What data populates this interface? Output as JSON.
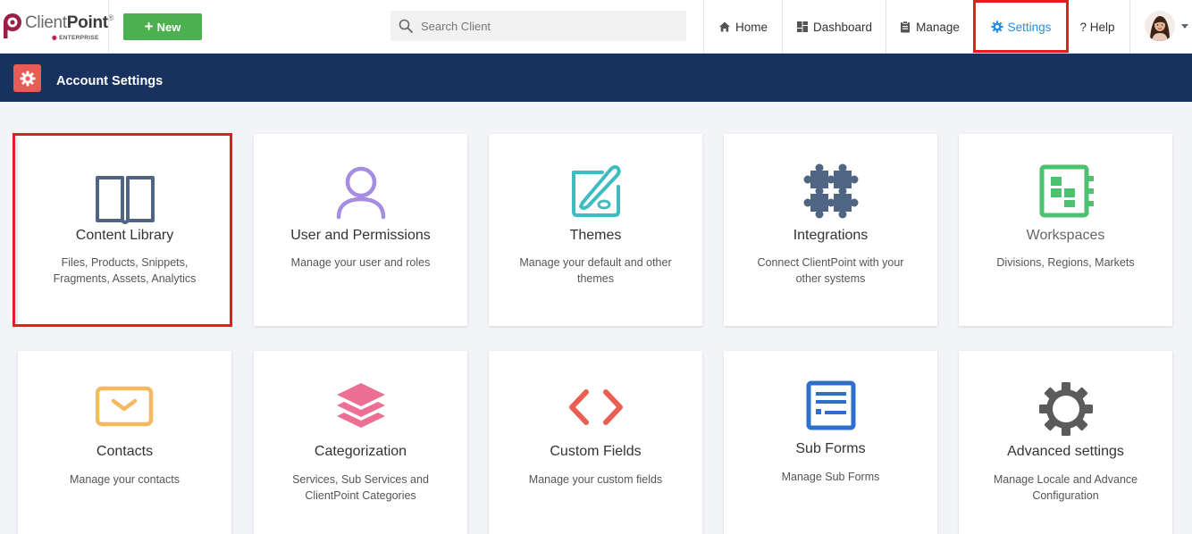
{
  "app": {
    "logo_text_light": "Client",
    "logo_text_bold": "Point",
    "logo_reg": "®",
    "logo_edition": "ENTERPRISE"
  },
  "toolbar": {
    "new_label": "New"
  },
  "search": {
    "placeholder": "Search Client",
    "value": ""
  },
  "nav": {
    "home": "Home",
    "dashboard": "Dashboard",
    "manage": "Manage",
    "settings": "Settings",
    "help": "? Help"
  },
  "header": {
    "title": "Account Settings"
  },
  "cards": [
    {
      "title": "Content Library",
      "desc": "Files, Products, Snippets, Fragments, Assets, Analytics",
      "icon": "book-icon"
    },
    {
      "title": "User and Permissions",
      "desc": "Manage your user and roles",
      "icon": "user-icon"
    },
    {
      "title": "Themes",
      "desc": "Manage your default and other themes",
      "icon": "palette-icon"
    },
    {
      "title": "Integrations",
      "desc": "Connect ClientPoint with your other systems",
      "icon": "puzzle-icon"
    },
    {
      "title": "Workspaces",
      "desc": "Divisions, Regions, Markets",
      "icon": "workspace-icon"
    },
    {
      "title": "Contacts",
      "desc": "Manage your contacts",
      "icon": "envelope-icon"
    },
    {
      "title": "Categorization",
      "desc": "Services, Sub Services and ClientPoint Categories",
      "icon": "layers-icon"
    },
    {
      "title": "Custom Fields",
      "desc": "Manage your custom fields",
      "icon": "code-icon"
    },
    {
      "title": "Sub Forms",
      "desc": "Manage Sub Forms",
      "icon": "form-icon"
    },
    {
      "title": "Advanced settings",
      "desc": "Manage Locale and Advance Configuration",
      "icon": "cog-icon"
    }
  ],
  "colors": {
    "accent": "#2a8de4",
    "header_bg": "#17325f",
    "new_button": "#4caf50",
    "highlight": "#e02020"
  }
}
